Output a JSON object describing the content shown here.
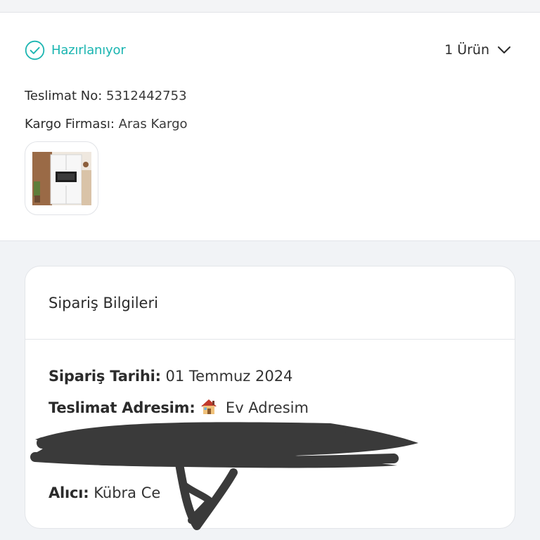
{
  "shipment": {
    "status_label": "Hazırlanıyor",
    "status_icon": "check-circle-icon",
    "status_color": "#1bb5b1",
    "items_toggle_label": "1 Ürün",
    "delivery_no_label": "Teslimat No:",
    "delivery_no_value": "5312442753",
    "carrier_label": "Kargo Firması:",
    "carrier_value": "Aras Kargo",
    "product_thumbnail": "kitchen-cabinet-product-image"
  },
  "order_info": {
    "title": "Sipariş Bilgileri",
    "order_date_label": "Sipariş Tarihi:",
    "order_date_value": "01 Temmuz 2024",
    "address_label": "Teslimat Adresim:",
    "address_icon": "house-emoji-icon",
    "address_value": "Ev Adresim",
    "receiver_label": "Alıcı:",
    "receiver_value": "Kübra  Ce"
  }
}
